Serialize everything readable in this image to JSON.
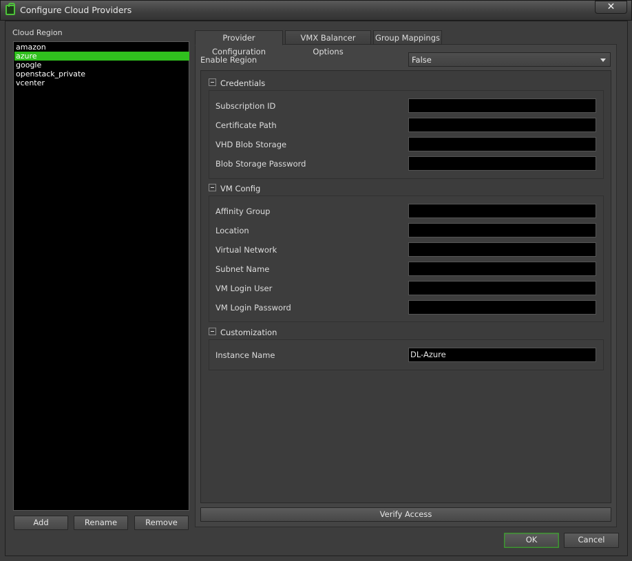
{
  "window": {
    "title": "Configure Cloud Providers",
    "close_glyph": "✕"
  },
  "left": {
    "label": "Cloud Region",
    "regions": [
      "amazon",
      "azure",
      "google",
      "openstack_private",
      "vcenter"
    ],
    "selected_region": "azure",
    "buttons": {
      "add": "Add",
      "rename": "Rename",
      "remove": "Remove"
    }
  },
  "tabs": [
    "Provider Configuration",
    "VMX Balancer Options",
    "Group Mappings"
  ],
  "active_tab": "Provider Configuration",
  "enable_region": {
    "label": "Enable Region",
    "value": "False"
  },
  "sections": {
    "credentials": {
      "title": "Credentials",
      "fields": [
        {
          "label": "Subscription ID",
          "value": ""
        },
        {
          "label": "Certificate Path",
          "value": ""
        },
        {
          "label": "VHD Blob Storage",
          "value": ""
        },
        {
          "label": "Blob Storage Password",
          "value": ""
        }
      ]
    },
    "vm_config": {
      "title": "VM Config",
      "fields": [
        {
          "label": "Affinity Group",
          "value": ""
        },
        {
          "label": "Location",
          "value": ""
        },
        {
          "label": "Virtual Network",
          "value": ""
        },
        {
          "label": "Subnet Name",
          "value": ""
        },
        {
          "label": "VM Login User",
          "value": ""
        },
        {
          "label": "VM Login Password",
          "value": ""
        }
      ]
    },
    "customization": {
      "title": "Customization",
      "fields": [
        {
          "label": "Instance Name",
          "value": "DL-Azure"
        }
      ]
    }
  },
  "verify_access_label": "Verify Access",
  "dialog_buttons": {
    "ok": "OK",
    "cancel": "Cancel"
  },
  "colors": {
    "selection": "#30c01e",
    "ok_border": "#3c9d2e",
    "background": "#3d3d3d"
  }
}
